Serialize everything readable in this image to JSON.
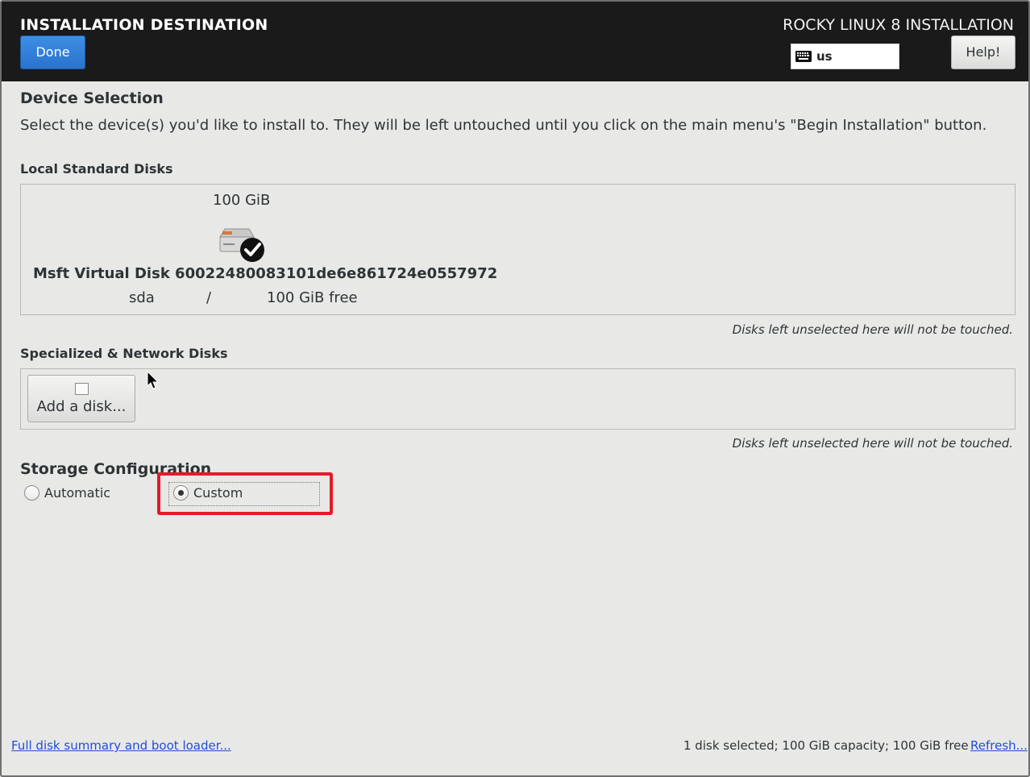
{
  "header": {
    "title": "INSTALLATION DESTINATION",
    "product": "ROCKY LINUX 8 INSTALLATION",
    "done_label": "Done",
    "help_label": "Help!",
    "keyboard_layout": "us",
    "keyboard_icon": "keyboard-icon"
  },
  "device_selection": {
    "title": "Device Selection",
    "instruction": "Select the device(s) you'd like to install to.  They will be left untouched until you click on the main menu's \"Begin Installation\" button."
  },
  "local_disks": {
    "title": "Local Standard Disks",
    "disks": [
      {
        "size": "100 GiB",
        "name": "Msft Virtual Disk 60022480083101de6e861724e0557972",
        "device": "sda",
        "separator": "/",
        "free": "100 GiB free",
        "selected": true,
        "icon": "hard-disk-icon"
      }
    ],
    "note": "Disks left unselected here will not be touched."
  },
  "network_disks": {
    "title": "Specialized & Network Disks",
    "add_label": "Add a disk...",
    "note": "Disks left unselected here will not be touched."
  },
  "storage_config": {
    "title": "Storage Configuration",
    "options": [
      {
        "label": "Automatic",
        "selected": false
      },
      {
        "label": "Custom",
        "selected": true
      }
    ]
  },
  "footer": {
    "summary_link": "Full disk summary and boot loader...",
    "status": "1 disk selected; 100 GiB capacity; 100 GiB free",
    "refresh_link": "Refresh..."
  },
  "colors": {
    "header_bg": "#1a1a1a",
    "accent_blue": "#2a73cc",
    "highlight_red": "#e21b2a",
    "link_blue": "#1f4fd1"
  }
}
